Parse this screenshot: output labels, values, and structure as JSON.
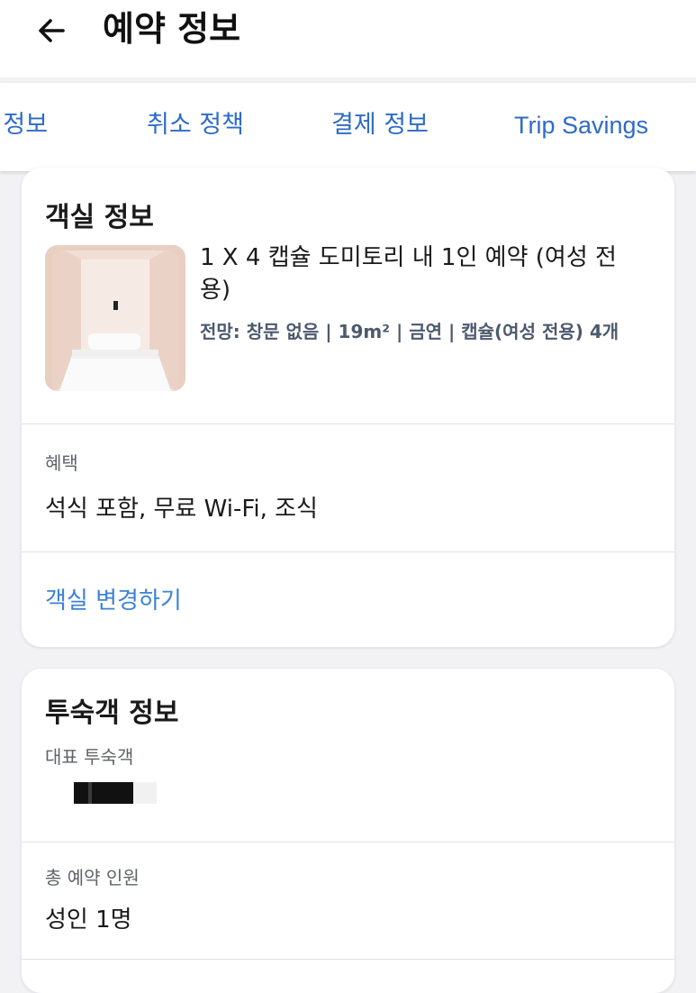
{
  "header": {
    "title": "예약 정보",
    "back_icon": "arrow-left-icon"
  },
  "tabs": [
    {
      "label": "객실 정보",
      "visible_text": "객 정보",
      "active": false
    },
    {
      "label": "취소 정책",
      "active": true
    },
    {
      "label": "결제 정보",
      "active": false
    },
    {
      "label": "Trip Savings",
      "active": false
    }
  ],
  "colors": {
    "accent": "#3a78d4",
    "tab_text": "#2e6bc7",
    "link": "#3b82d6"
  },
  "room_card": {
    "title": "객실 정보",
    "room_name": "1 X 4 캡슐 도미토리 내 1인 예약 (여성 전용)",
    "room_attributes": "전망: 창문 없음 | 19m² | 금연 | 캡슐(여성 전용) 4개",
    "benefits_label": "혜택",
    "benefits_value": "석식 포함, 무료 Wi-Fi, 조식",
    "change_room_link": "객실 변경하기"
  },
  "guest_card": {
    "title": "투숙객 정보",
    "lead_guest_label": "대표 투숙객",
    "total_guests_label": "총 예약 인원",
    "total_guests_value": "성인 1명"
  }
}
